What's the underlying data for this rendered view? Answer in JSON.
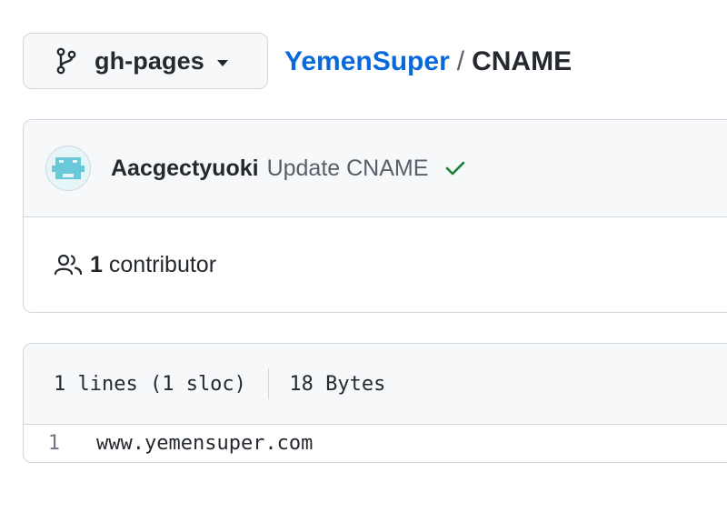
{
  "branch": {
    "icon": "git-branch-icon",
    "label": "gh-pages",
    "caret_icon": "triangle-down-icon"
  },
  "breadcrumb": {
    "repo": "YemenSuper",
    "separator": "/",
    "file": "CNAME"
  },
  "commit": {
    "author": "Aacgectyuoki",
    "message": "Update CNAME",
    "status_icon": "check-icon",
    "status_color": "#1a7f37"
  },
  "contributors": {
    "icon": "people-icon",
    "count": "1",
    "label": "contributor"
  },
  "file": {
    "lines_info": "1 lines (1 sloc)",
    "size": "18 Bytes",
    "lines": [
      {
        "number": "1",
        "code": "www.yemensuper.com"
      }
    ]
  },
  "colors": {
    "link": "#0969da",
    "border": "#d0d7de",
    "header_bg": "#f6f8fa",
    "muted": "#57606a"
  }
}
